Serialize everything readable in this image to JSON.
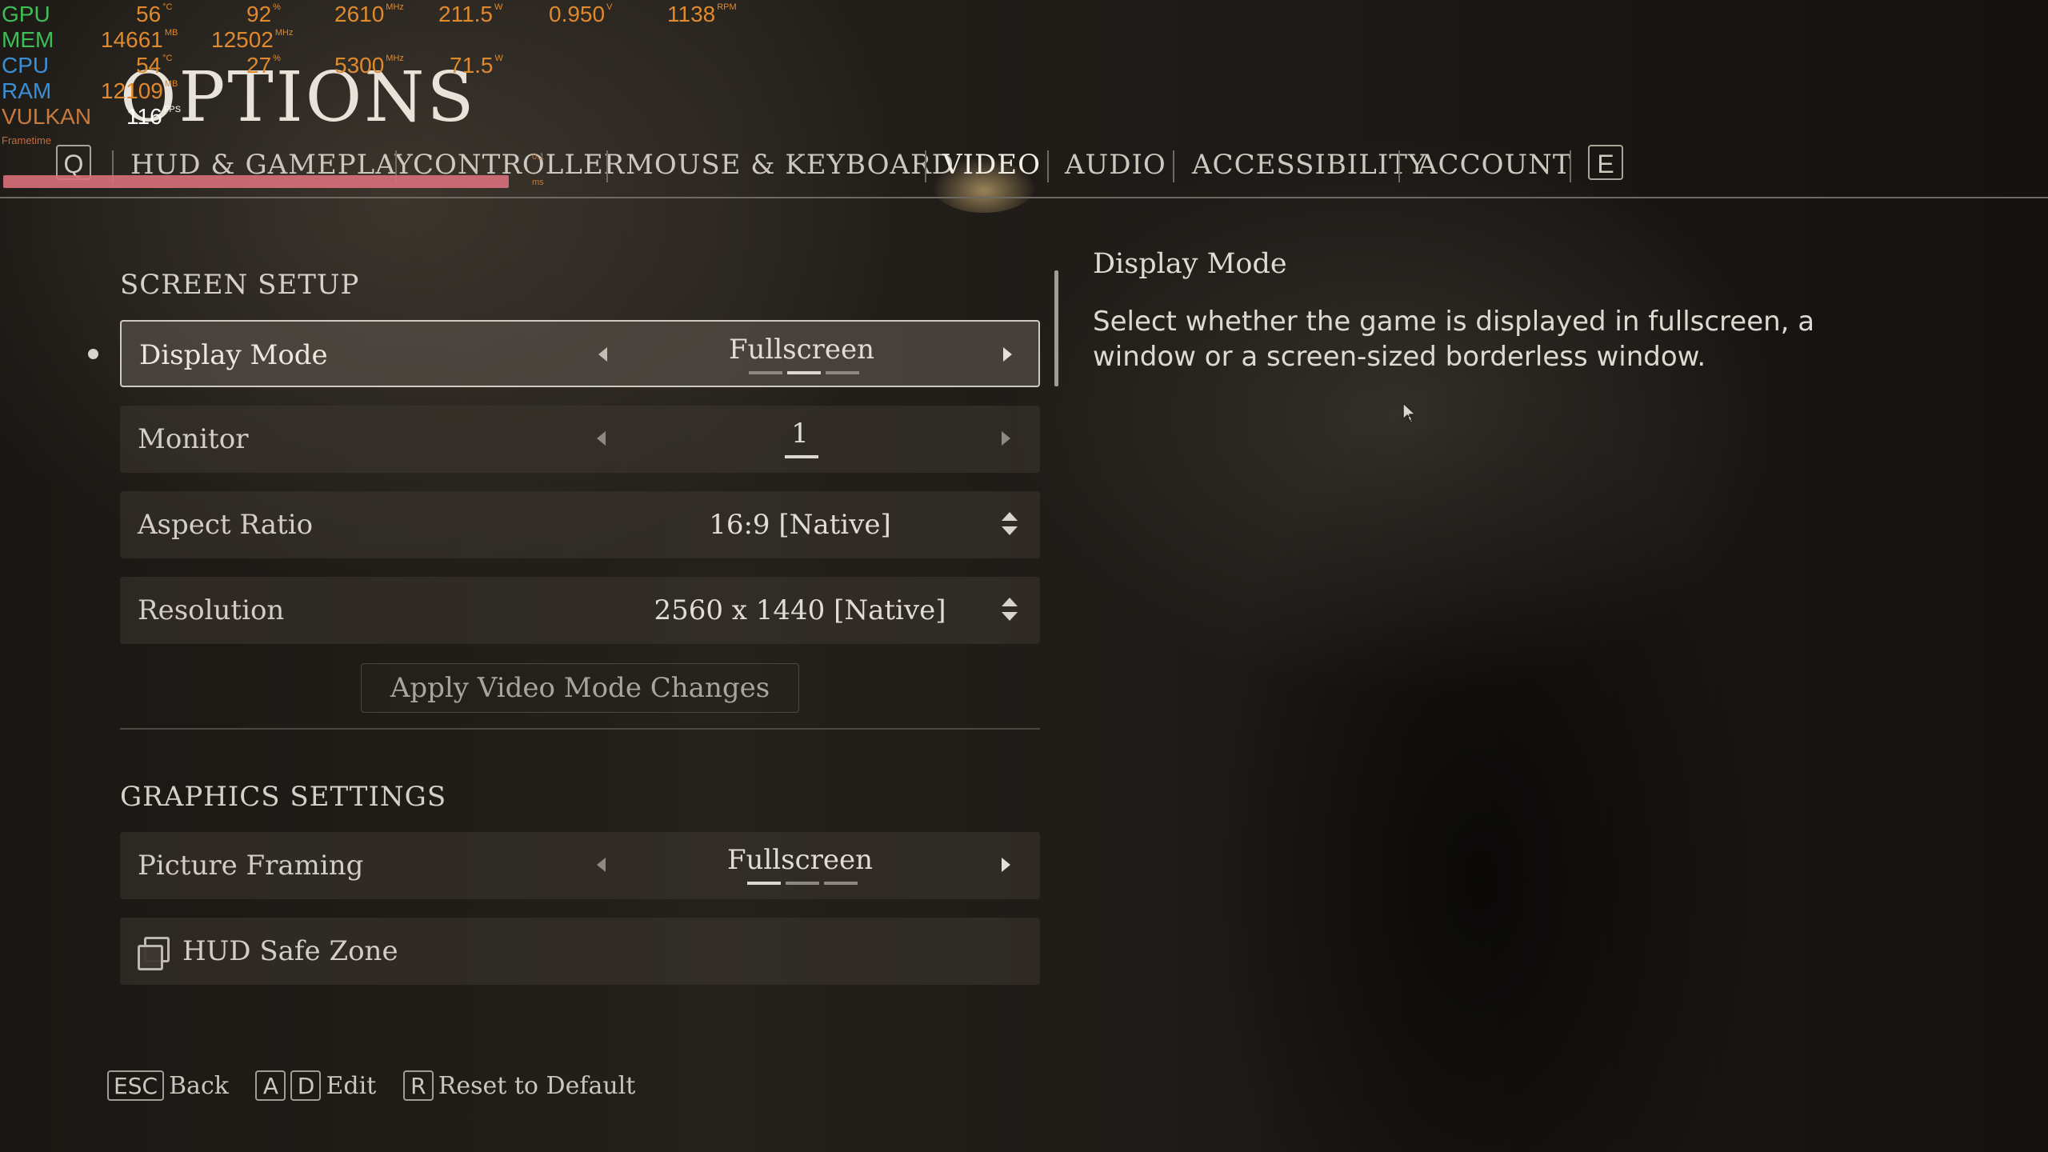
{
  "overlay": {
    "gpu": {
      "label": "GPU",
      "temp": "56",
      "temp_unit": "°C",
      "load": "92",
      "load_unit": "%",
      "clock": "2610",
      "clock_unit": "MHz",
      "power": "211.5",
      "power_unit": "W",
      "voltage": "0.950",
      "voltage_unit": "V",
      "fan": "1138",
      "fan_unit": "RPM"
    },
    "mem": {
      "label": "MEM",
      "used": "14661",
      "used_unit": "MB",
      "clock": "12502",
      "clock_unit": "MHz"
    },
    "cpu": {
      "label": "CPU",
      "temp": "54",
      "temp_unit": "°C",
      "load": "27",
      "load_unit": "%",
      "clock": "5300",
      "clock_unit": "MHz",
      "power": "71.5",
      "power_unit": "W"
    },
    "ram": {
      "label": "RAM",
      "used": "12109",
      "used_unit": "MB"
    },
    "api": {
      "label": "VULKAN",
      "fps": "116",
      "fps_unit": "FPS"
    },
    "frametime_label": "Frametime",
    "frametime_ms": "0.1 ms"
  },
  "header": {
    "title": "OPTIONS",
    "prev_key": "Q",
    "next_key": "E",
    "tabs": [
      "HUD & GAMEPLAY",
      "CONTROLLER",
      "MOUSE & KEYBOARD",
      "VIDEO",
      "AUDIO",
      "ACCESSIBILITY",
      "ACCOUNT"
    ],
    "active_tab": "VIDEO"
  },
  "screen_setup": {
    "title": "SCREEN SETUP",
    "display_mode": {
      "label": "Display Mode",
      "value": "Fullscreen",
      "option_index": 2,
      "option_count": 3
    },
    "monitor": {
      "label": "Monitor",
      "value": "1"
    },
    "aspect_ratio": {
      "label": "Aspect Ratio",
      "value": "16:9 [Native]"
    },
    "resolution": {
      "label": "Resolution",
      "value": "2560 x 1440 [Native]"
    },
    "apply_label": "Apply Video Mode Changes"
  },
  "graphics_settings": {
    "title": "GRAPHICS SETTINGS",
    "picture_framing": {
      "label": "Picture Framing",
      "value": "Fullscreen",
      "option_index": 1,
      "option_count": 3
    },
    "hud_safe_zone": {
      "label": "HUD Safe Zone"
    }
  },
  "description": {
    "title": "Display Mode",
    "body": "Select whether the game is displayed in fullscreen, a window or a screen-sized borderless window."
  },
  "footer": {
    "back_key": "ESC",
    "back_label": "Back",
    "edit_key_1": "A",
    "edit_key_2": "D",
    "edit_label": "Edit",
    "reset_key": "R",
    "reset_label": "Reset to Default"
  }
}
